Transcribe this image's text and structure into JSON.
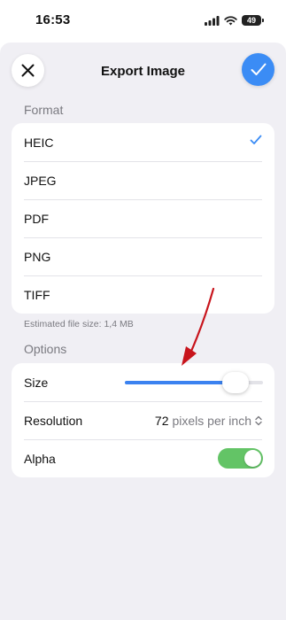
{
  "status_bar": {
    "time": "16:53",
    "battery": "49"
  },
  "nav": {
    "title": "Export Image"
  },
  "format": {
    "header": "Format",
    "options": [
      {
        "label": "HEIC",
        "selected": true
      },
      {
        "label": "JPEG",
        "selected": false
      },
      {
        "label": "PDF",
        "selected": false
      },
      {
        "label": "PNG",
        "selected": false
      },
      {
        "label": "TIFF",
        "selected": false
      }
    ],
    "estimated_size": "Estimated file size: 1,4 MB"
  },
  "options": {
    "header": "Options",
    "size_label": "Size",
    "size_value_fraction": 0.8,
    "resolution_label": "Resolution",
    "resolution_value": "72",
    "resolution_unit": "pixels per inch",
    "alpha_label": "Alpha",
    "alpha_on": true
  },
  "colors": {
    "accent": "#3b8cf5",
    "toggle_on": "#63c466",
    "annotation_arrow": "#c8141c"
  }
}
